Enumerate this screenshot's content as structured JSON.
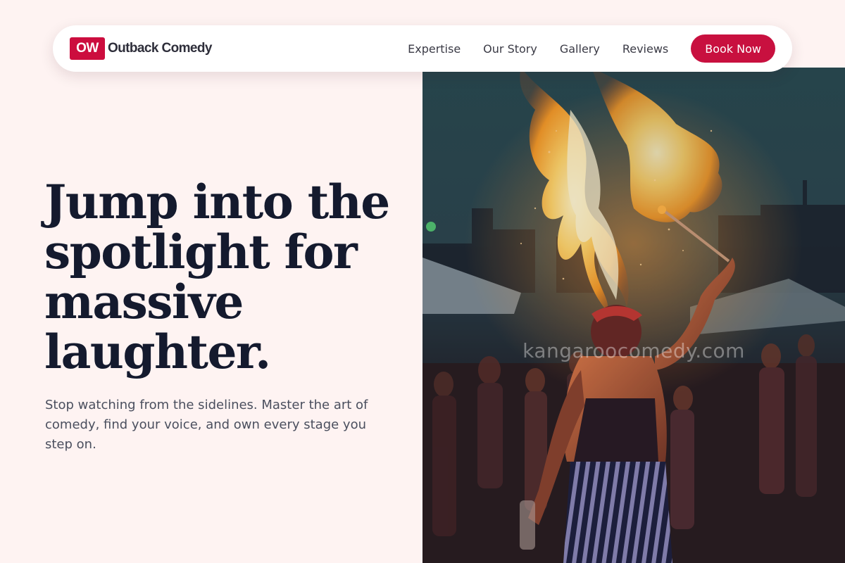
{
  "brand": {
    "logo_mark": "OW",
    "name": "Outback Comedy"
  },
  "nav": {
    "links": [
      "Expertise",
      "Our Story",
      "Gallery",
      "Reviews"
    ],
    "cta": "Book Now"
  },
  "hero": {
    "title": "Jump into the spotlight for massive laughter.",
    "subtitle": "Stop watching from the sidelines. Master the art of comedy, find your voice, and own every stage you step on.",
    "image_watermark": "kangaroocomedy.com"
  },
  "colors": {
    "accent": "#c8103f",
    "page_background": "#fef3f2",
    "heading": "#141a2e"
  }
}
